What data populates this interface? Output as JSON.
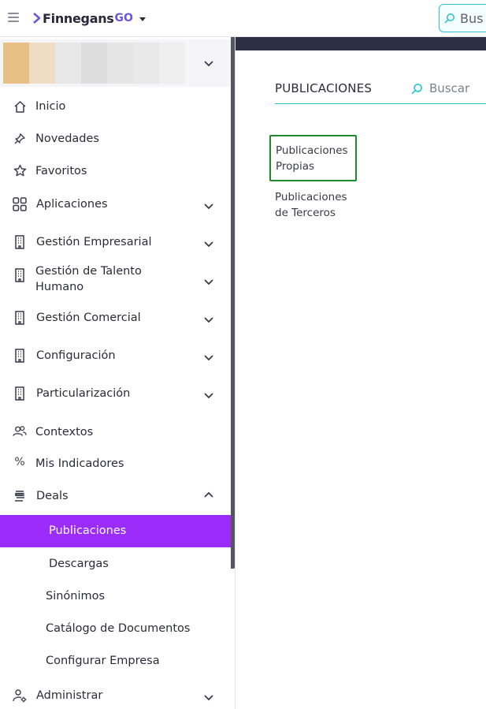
{
  "header": {
    "menu_icon": "hamburger-icon",
    "logo_text": "Finnegans",
    "logo_suffix": "GO",
    "search_placeholder": "Buscar",
    "search_visible_text": "Bus"
  },
  "sidebar": {
    "context_swatches": [
      "#e8bf85",
      "#f0dcc2",
      "#e7e7e7",
      "#dddddd",
      "#e4e4e4",
      "#e9e9e9",
      "#efefef"
    ],
    "items": [
      {
        "label": "Inicio",
        "icon": "home-icon"
      },
      {
        "label": "Novedades",
        "icon": "pin-icon"
      },
      {
        "label": "Favoritos",
        "icon": "star-icon"
      },
      {
        "label": "Aplicaciones",
        "icon": "grid-icon",
        "expandable": true
      },
      {
        "label": "Gestión Empresarial",
        "icon": "building-icon",
        "expandable": true
      },
      {
        "label": "Gestión de Talento Humano",
        "icon": "building-icon",
        "expandable": true
      },
      {
        "label": "Gestión Comercial",
        "icon": "building-icon",
        "expandable": true
      },
      {
        "label": "Configuración",
        "icon": "building-icon",
        "expandable": true
      },
      {
        "label": "Particularización",
        "icon": "building-icon",
        "expandable": true
      },
      {
        "label": "Contextos",
        "icon": "users-icon"
      },
      {
        "label": "Mis Indicadores",
        "icon": "percent-icon"
      },
      {
        "label": "Deals",
        "icon": "stack-icon",
        "expanded": true
      },
      {
        "label": "Publicaciones",
        "active": true
      },
      {
        "label": "Descargas"
      },
      {
        "label": "Sinónimos"
      },
      {
        "label": "Catálogo de Documentos"
      },
      {
        "label": "Configurar Empresa"
      },
      {
        "label": "Administrar",
        "icon": "user-gear-icon",
        "expandable": true
      }
    ]
  },
  "main": {
    "title": "PUBLICACIONES",
    "search_placeholder": "Buscar",
    "cards": [
      {
        "label": "Publicaciones Propias",
        "selected": true
      },
      {
        "label": "Publicaciones de Terceros",
        "selected": false
      }
    ]
  },
  "colors": {
    "accent_active": "#9b2cfa",
    "search_border": "#2ec4d6",
    "selected_border": "#1f8a2c",
    "dark_strip": "#2d2f45"
  }
}
